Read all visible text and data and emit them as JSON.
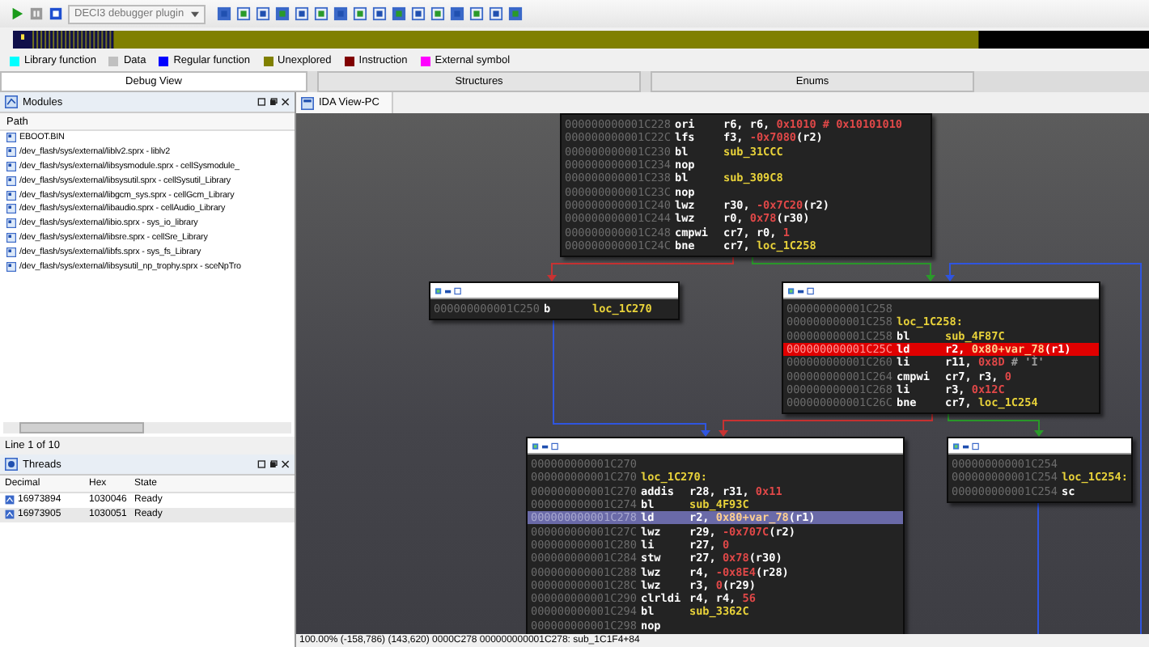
{
  "toolbar": {
    "debugger": {
      "value": "DECI3 debugger plugin"
    }
  },
  "legend": [
    {
      "label": "Library function",
      "color": "#00ffff"
    },
    {
      "label": "Data",
      "color": "#c0c0c0"
    },
    {
      "label": "Regular function",
      "color": "#0000ff"
    },
    {
      "label": "Unexplored",
      "color": "#808000"
    },
    {
      "label": "Instruction",
      "color": "#800000"
    },
    {
      "label": "External symbol",
      "color": "#ff00ff"
    }
  ],
  "tabs": [
    {
      "label": "Debug View",
      "selected": true
    },
    {
      "label": "Structures",
      "selected": false
    },
    {
      "label": "Enums",
      "selected": false
    }
  ],
  "modules_panel": {
    "title": "Modules",
    "column": "Path",
    "rows": [
      "EBOOT.BIN",
      "/dev_flash/sys/external/liblv2.sprx - liblv2",
      "/dev_flash/sys/external/libsysmodule.sprx - cellSysmodule_",
      "/dev_flash/sys/external/libsysutil.sprx - cellSysutil_Library",
      "/dev_flash/sys/external/libgcm_sys.sprx - cellGcm_Library",
      "/dev_flash/sys/external/libaudio.sprx - cellAudio_Library",
      "/dev_flash/sys/external/libio.sprx - sys_io_library",
      "/dev_flash/sys/external/libsre.sprx - cellSre_Library",
      "/dev_flash/sys/external/libfs.sprx - sys_fs_Library",
      "/dev_flash/sys/external/libsysutil_np_trophy.sprx - sceNpTro"
    ],
    "status": "Line 1 of 10"
  },
  "threads_panel": {
    "title": "Threads",
    "columns": [
      "Decimal",
      "Hex",
      "State"
    ],
    "rows": [
      {
        "cells": [
          "16973894",
          "1030046",
          "Ready"
        ],
        "selected": false
      },
      {
        "cells": [
          "16973905",
          "1030051",
          "Ready"
        ],
        "selected": true
      }
    ]
  },
  "graph_view": {
    "title": "IDA View-PC",
    "nodes": [
      {
        "header": false,
        "lines": [
          {
            "address": "000000000001C228",
            "mnemonic": "ori",
            "operands": [
              {
                "text": "r6, r6, ",
                "kind": "text"
              },
              {
                "text": "0x1010 # 0x10101010",
                "kind": "num"
              }
            ]
          },
          {
            "address": "000000000001C22C",
            "mnemonic": "lfs",
            "operands": [
              {
                "text": "f3, ",
                "kind": "text"
              },
              {
                "text": "-0x7080",
                "kind": "num"
              },
              {
                "text": "(r2)",
                "kind": "text"
              }
            ]
          },
          {
            "address": "000000000001C230",
            "mnemonic": "bl",
            "operands": [
              {
                "text": "sub_31CCC",
                "kind": "name"
              }
            ]
          },
          {
            "address": "000000000001C234",
            "mnemonic": "nop"
          },
          {
            "address": "000000000001C238",
            "mnemonic": "bl",
            "operands": [
              {
                "text": "sub_309C8",
                "kind": "name"
              }
            ]
          },
          {
            "address": "000000000001C23C",
            "mnemonic": "nop"
          },
          {
            "address": "000000000001C240",
            "mnemonic": "lwz",
            "operands": [
              {
                "text": "r30, ",
                "kind": "text"
              },
              {
                "text": "-0x7C20",
                "kind": "num"
              },
              {
                "text": "(r2)",
                "kind": "text"
              }
            ]
          },
          {
            "address": "000000000001C244",
            "mnemonic": "lwz",
            "operands": [
              {
                "text": "r0, ",
                "kind": "text"
              },
              {
                "text": "0x78",
                "kind": "num"
              },
              {
                "text": "(r30)",
                "kind": "text"
              }
            ]
          },
          {
            "address": "000000000001C248",
            "mnemonic": "cmpwi",
            "operands": [
              {
                "text": "cr7, r0, ",
                "kind": "text"
              },
              {
                "text": "1",
                "kind": "num"
              }
            ]
          },
          {
            "address": "000000000001C24C",
            "mnemonic": "bne",
            "operands": [
              {
                "text": "cr7, ",
                "kind": "text"
              },
              {
                "text": "loc_1C258",
                "kind": "name"
              }
            ]
          }
        ]
      },
      {
        "header": true,
        "lines": [
          {
            "address": "000000000001C250",
            "mnemonic": "b",
            "operands": [
              {
                "text": "loc_1C270",
                "kind": "name"
              }
            ]
          }
        ]
      },
      {
        "header": true,
        "lines": [
          {
            "address": "000000000001C258"
          },
          {
            "address": "000000000001C258",
            "label": "loc_1C258:"
          },
          {
            "address": "000000000001C258",
            "mnemonic": "bl",
            "operands": [
              {
                "text": "sub_4F87C",
                "kind": "name"
              }
            ]
          },
          {
            "address": "000000000001C25C",
            "mnemonic": "ld",
            "operands": [
              {
                "text": "r2, ",
                "kind": "text"
              },
              {
                "text": "0x80+var_78",
                "kind": "num"
              },
              {
                "text": "(r1)",
                "kind": "text"
              }
            ],
            "breakpoint": true
          },
          {
            "address": "000000000001C260",
            "mnemonic": "li",
            "operands": [
              {
                "text": "r11, ",
                "kind": "text"
              },
              {
                "text": "0x8D",
                "kind": "num"
              },
              {
                "text": " # 'Ì'",
                "kind": "comment"
              }
            ]
          },
          {
            "address": "000000000001C264",
            "mnemonic": "cmpwi",
            "operands": [
              {
                "text": "cr7, r3, ",
                "kind": "text"
              },
              {
                "text": "0",
                "kind": "num"
              }
            ]
          },
          {
            "address": "000000000001C268",
            "mnemonic": "li",
            "operands": [
              {
                "text": "r3, ",
                "kind": "text"
              },
              {
                "text": "0x12C",
                "kind": "num"
              }
            ]
          },
          {
            "address": "000000000001C26C",
            "mnemonic": "bne",
            "operands": [
              {
                "text": "cr7, ",
                "kind": "text"
              },
              {
                "text": "loc_1C254",
                "kind": "name"
              }
            ]
          }
        ]
      },
      {
        "header": true,
        "lines": [
          {
            "address": "000000000001C270"
          },
          {
            "address": "000000000001C270",
            "label": "loc_1C270:"
          },
          {
            "address": "000000000001C270",
            "mnemonic": "addis",
            "operands": [
              {
                "text": "r28, r31, ",
                "kind": "text"
              },
              {
                "text": "0x11",
                "kind": "num"
              }
            ]
          },
          {
            "address": "000000000001C274",
            "mnemonic": "bl",
            "operands": [
              {
                "text": "sub_4F93C",
                "kind": "name"
              }
            ]
          },
          {
            "address": "000000000001C278",
            "mnemonic": "ld",
            "operands": [
              {
                "text": "r2, ",
                "kind": "text"
              },
              {
                "text": "0x80+var_78",
                "kind": "num"
              },
              {
                "text": "(r1)",
                "kind": "text"
              }
            ],
            "current": true
          },
          {
            "address": "000000000001C27C",
            "mnemonic": "lwz",
            "operands": [
              {
                "text": "r29, ",
                "kind": "text"
              },
              {
                "text": "-0x707C",
                "kind": "num"
              },
              {
                "text": "(r2)",
                "kind": "text"
              }
            ]
          },
          {
            "address": "000000000001C280",
            "mnemonic": "li",
            "operands": [
              {
                "text": "r27, ",
                "kind": "text"
              },
              {
                "text": "0",
                "kind": "num"
              }
            ]
          },
          {
            "address": "000000000001C284",
            "mnemonic": "stw",
            "operands": [
              {
                "text": "r27, ",
                "kind": "text"
              },
              {
                "text": "0x78",
                "kind": "num"
              },
              {
                "text": "(r30)",
                "kind": "text"
              }
            ]
          },
          {
            "address": "000000000001C288",
            "mnemonic": "lwz",
            "operands": [
              {
                "text": "r4, ",
                "kind": "text"
              },
              {
                "text": "-0x8E4",
                "kind": "num"
              },
              {
                "text": "(r28)",
                "kind": "text"
              }
            ]
          },
          {
            "address": "000000000001C28C",
            "mnemonic": "lwz",
            "operands": [
              {
                "text": "r3, ",
                "kind": "text"
              },
              {
                "text": "0",
                "kind": "num"
              },
              {
                "text": "(r29)",
                "kind": "text"
              }
            ]
          },
          {
            "address": "000000000001C290",
            "mnemonic": "clrldi",
            "operands": [
              {
                "text": "r4, r4, ",
                "kind": "text"
              },
              {
                "text": "56",
                "kind": "num"
              }
            ]
          },
          {
            "address": "000000000001C294",
            "mnemonic": "bl",
            "operands": [
              {
                "text": "sub_3362C",
                "kind": "name"
              }
            ]
          },
          {
            "address": "000000000001C298",
            "mnemonic": "nop"
          }
        ]
      },
      {
        "header": true,
        "lines": [
          {
            "address": "000000000001C254"
          },
          {
            "address": "000000000001C254",
            "label": "loc_1C254:"
          },
          {
            "address": "000000000001C254",
            "mnemonic": "sc"
          }
        ]
      }
    ]
  },
  "status_bar": "100.00% (-158,786) (143,620) 0000C278 000000000001C278: sub_1C1F4+84"
}
